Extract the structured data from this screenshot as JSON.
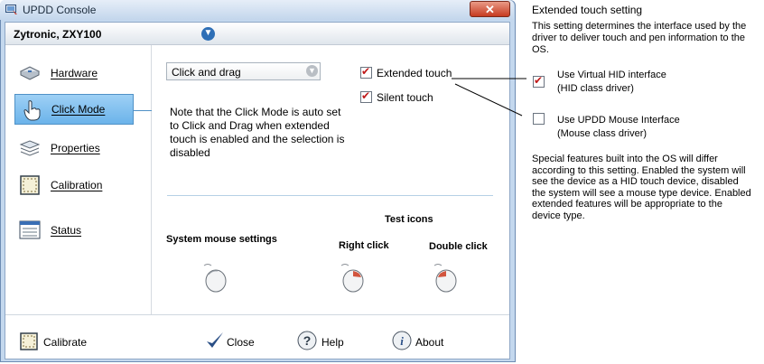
{
  "window": {
    "title": "UPDD Console",
    "close_label": "✕"
  },
  "device": {
    "name": "Zytronic, ZXY100"
  },
  "sidebar": {
    "items": [
      {
        "label": "Hardware",
        "icon": "hardware-icon"
      },
      {
        "label": "Click Mode",
        "icon": "hand-pointer-icon",
        "selected": true
      },
      {
        "label": "Properties",
        "icon": "properties-icon"
      },
      {
        "label": "Calibration",
        "icon": "calibration-icon"
      },
      {
        "label": "Status",
        "icon": "status-icon"
      }
    ]
  },
  "click_mode": {
    "selected_mode": "Click and drag",
    "note": "Note that the Click Mode is auto set to Click and Drag when extended touch is enabled and the selection is disabled",
    "extended_touch": {
      "label": "Extended touch",
      "checked": true
    },
    "silent_touch": {
      "label": "Silent touch",
      "checked": true
    }
  },
  "test": {
    "heading": "Test icons",
    "system_mouse": "System mouse settings",
    "right_click": "Right click",
    "double_click": "Double click"
  },
  "footer": {
    "calibrate": "Calibrate",
    "close": "Close",
    "help": "Help",
    "about": "About"
  },
  "annotation": {
    "title": "Extended touch setting",
    "description": "This setting determines the interface used by the driver to deliver touch and pen information to the OS.",
    "option1": {
      "line1": "Use Virtual HID interface",
      "line2": "(HID class driver)",
      "checked": true
    },
    "option2": {
      "line1": "Use UPDD Mouse Interface",
      "line2": "(Mouse class driver)",
      "checked": false
    },
    "footer": "Special features built into the OS will differ according to this setting. Enabled the system will see the device as a HID touch device, disabled the system will see a mouse type device. Enabled extended features will be appropriate to the device type."
  },
  "colors": {
    "selection": "#6bb3ea",
    "check": "#c01a1a",
    "accent_blue": "#2f6fb6"
  }
}
